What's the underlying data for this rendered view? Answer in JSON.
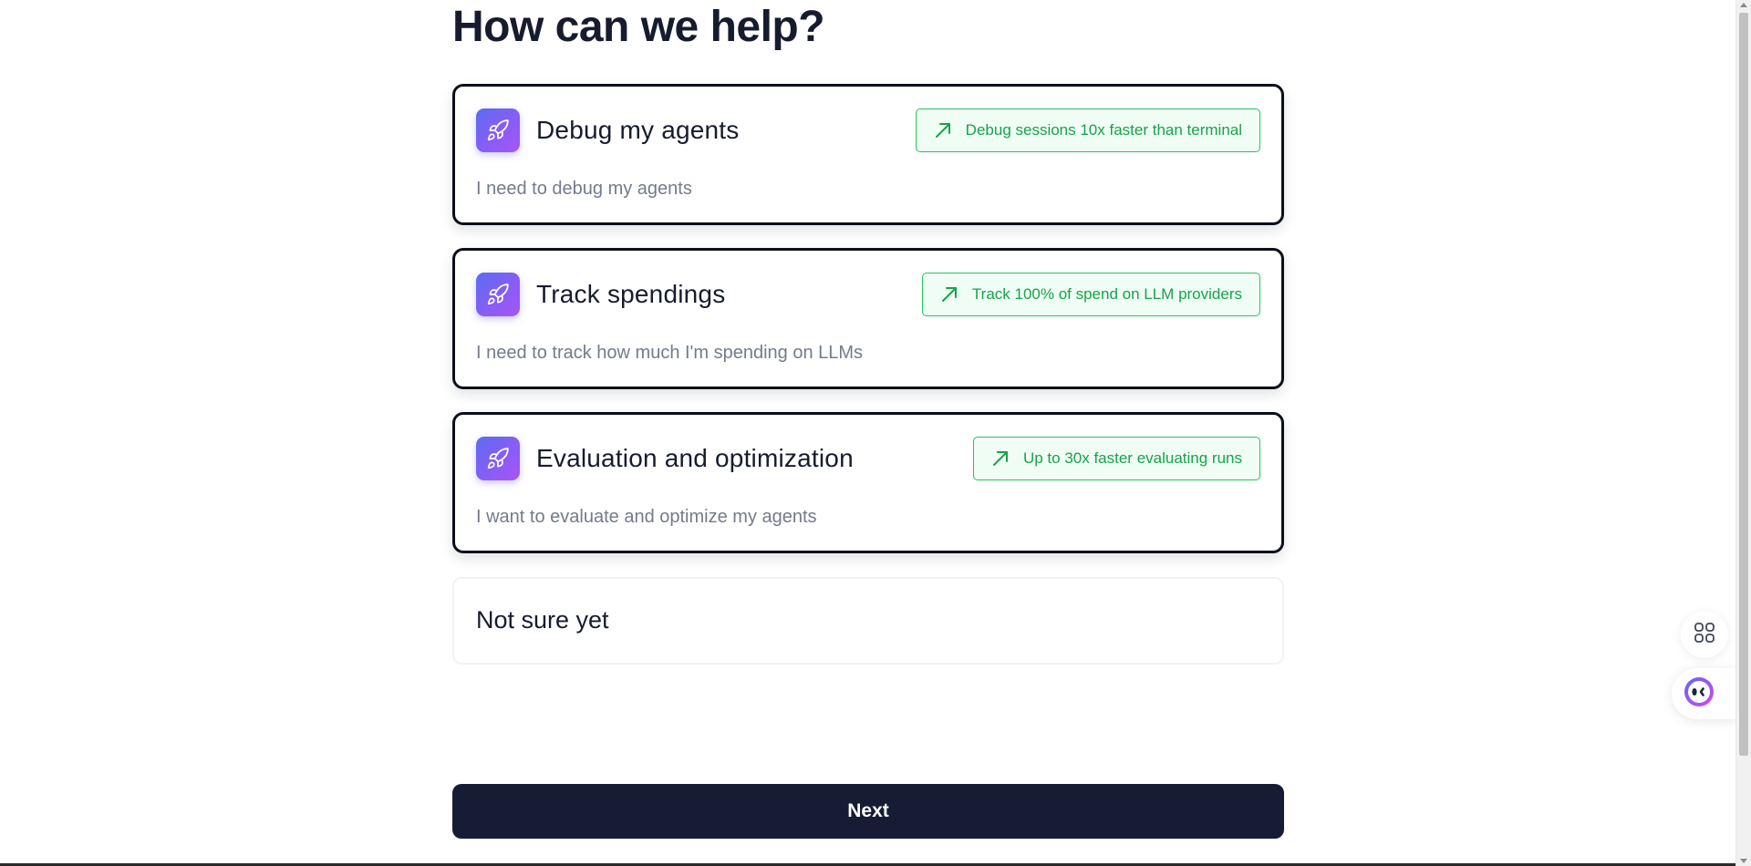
{
  "page": {
    "heading": "How can we help?"
  },
  "options": [
    {
      "title": "Debug my agents",
      "description": "I need to debug my agents",
      "badge": "Debug sessions 10x faster than terminal",
      "icon": "rocket-icon"
    },
    {
      "title": "Track spendings",
      "description": "I need to track how much I'm spending on LLMs",
      "badge": "Track 100% of spend on LLM providers",
      "icon": "rocket-icon"
    },
    {
      "title": "Evaluation and optimization",
      "description": "I want to evaluate and optimize my agents",
      "badge": "Up to 30x faster evaluating runs",
      "icon": "rocket-icon"
    }
  ],
  "not_sure": {
    "label": "Not sure yet"
  },
  "actions": {
    "next_label": "Next"
  },
  "floating": {
    "apps_icon": "apps-grid-icon",
    "assistant_icon": "assistant-face-icon"
  },
  "colors": {
    "heading": "#161c2e",
    "card_border": "#0b0f1a",
    "badge_green": "#16a34a",
    "badge_bg": "#f0fdf4",
    "icon_gradient_start": "#5b6cf2",
    "icon_gradient_end": "#a855f7",
    "next_button_bg": "#151c33"
  }
}
